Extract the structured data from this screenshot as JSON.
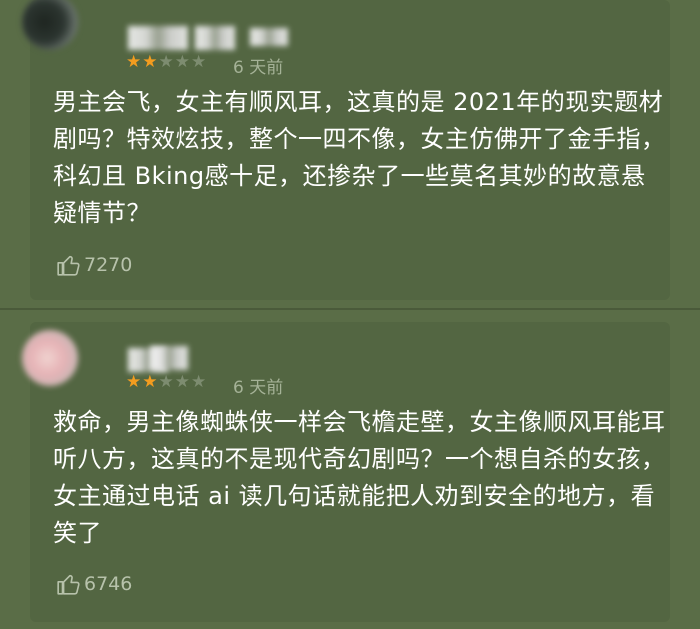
{
  "comments": [
    {
      "rating": 2,
      "max_rating": 5,
      "time": "6 天前",
      "text": "男主会飞，女主有顺风耳，这真的是 2021年的现实题材剧吗？特效炫技，整个一四不像，女主仿佛开了金手指，科幻且 Bking感十足，还掺杂了一些莫名其妙的故意悬疑情节？",
      "likes": "7270",
      "like_icon": "thumbs-up-icon"
    },
    {
      "rating": 2,
      "max_rating": 5,
      "time": "6 天前",
      "text": "救命，男主像蜘蛛侠一样会飞檐走壁，女主像顺风耳能耳听八方，这真的不是现代奇幻剧吗？一个想自杀的女孩，女主通过电话 ai 读几句话就能把人劝到安全的地方，看笑了",
      "likes": "6746",
      "like_icon": "thumbs-up-icon"
    }
  ],
  "colors": {
    "background": "#5a6d47",
    "star_on": "#f39c1f",
    "star_off": "#7d8c70",
    "text": "#ffffff",
    "meta": "#a5b297"
  }
}
